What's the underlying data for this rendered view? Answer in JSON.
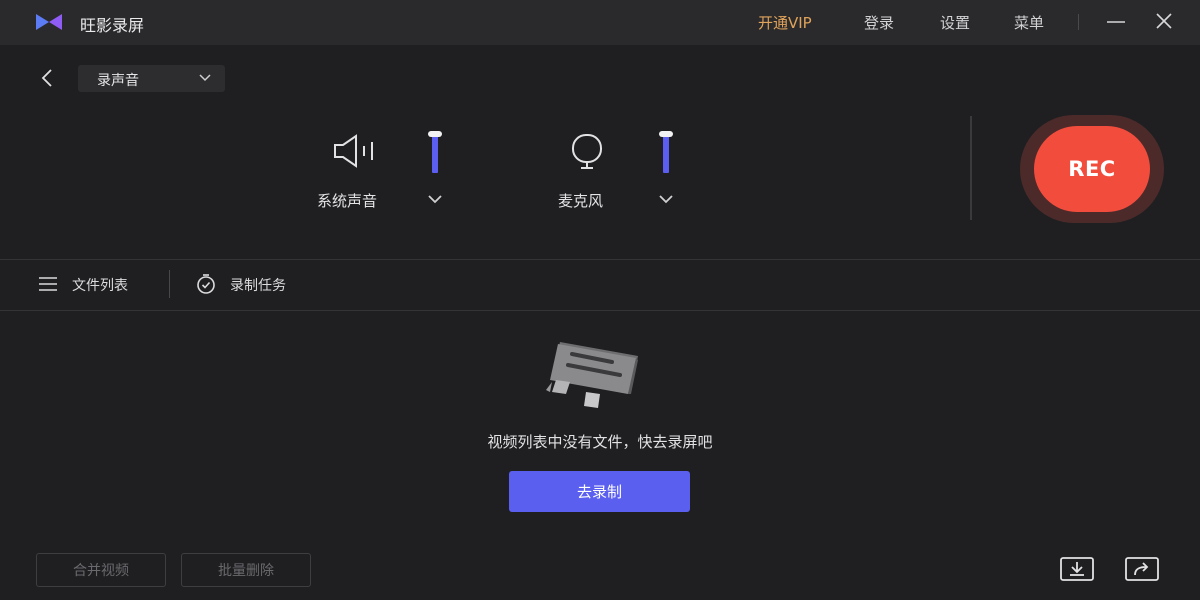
{
  "app": {
    "title": "旺影录屏"
  },
  "titlebar": {
    "vip": "开通VIP",
    "login": "登录",
    "settings": "设置",
    "menu": "菜单"
  },
  "mode": {
    "selected": "录声音"
  },
  "audio": {
    "system": {
      "label": "系统声音",
      "icon": "speaker-icon",
      "level": 1.0
    },
    "mic": {
      "label": "麦克风",
      "icon": "microphone-icon",
      "level": 1.0
    }
  },
  "rec": {
    "label": "REC"
  },
  "tabs": [
    {
      "label": "文件列表",
      "icon": "list-icon"
    },
    {
      "label": "录制任务",
      "icon": "timer-icon"
    }
  ],
  "empty": {
    "message": "视频列表中没有文件，快去录屏吧",
    "button": "去录制"
  },
  "footer": {
    "merge": "合并视频",
    "batch_delete": "批量删除",
    "import_icon": "download-icon",
    "share_icon": "share-icon"
  },
  "colors": {
    "accent": "#5a5ff0",
    "rec": "#f24c3d",
    "vip": "#e0a35a",
    "background": "#1f1f21",
    "titlebar": "#2a2a2d"
  }
}
